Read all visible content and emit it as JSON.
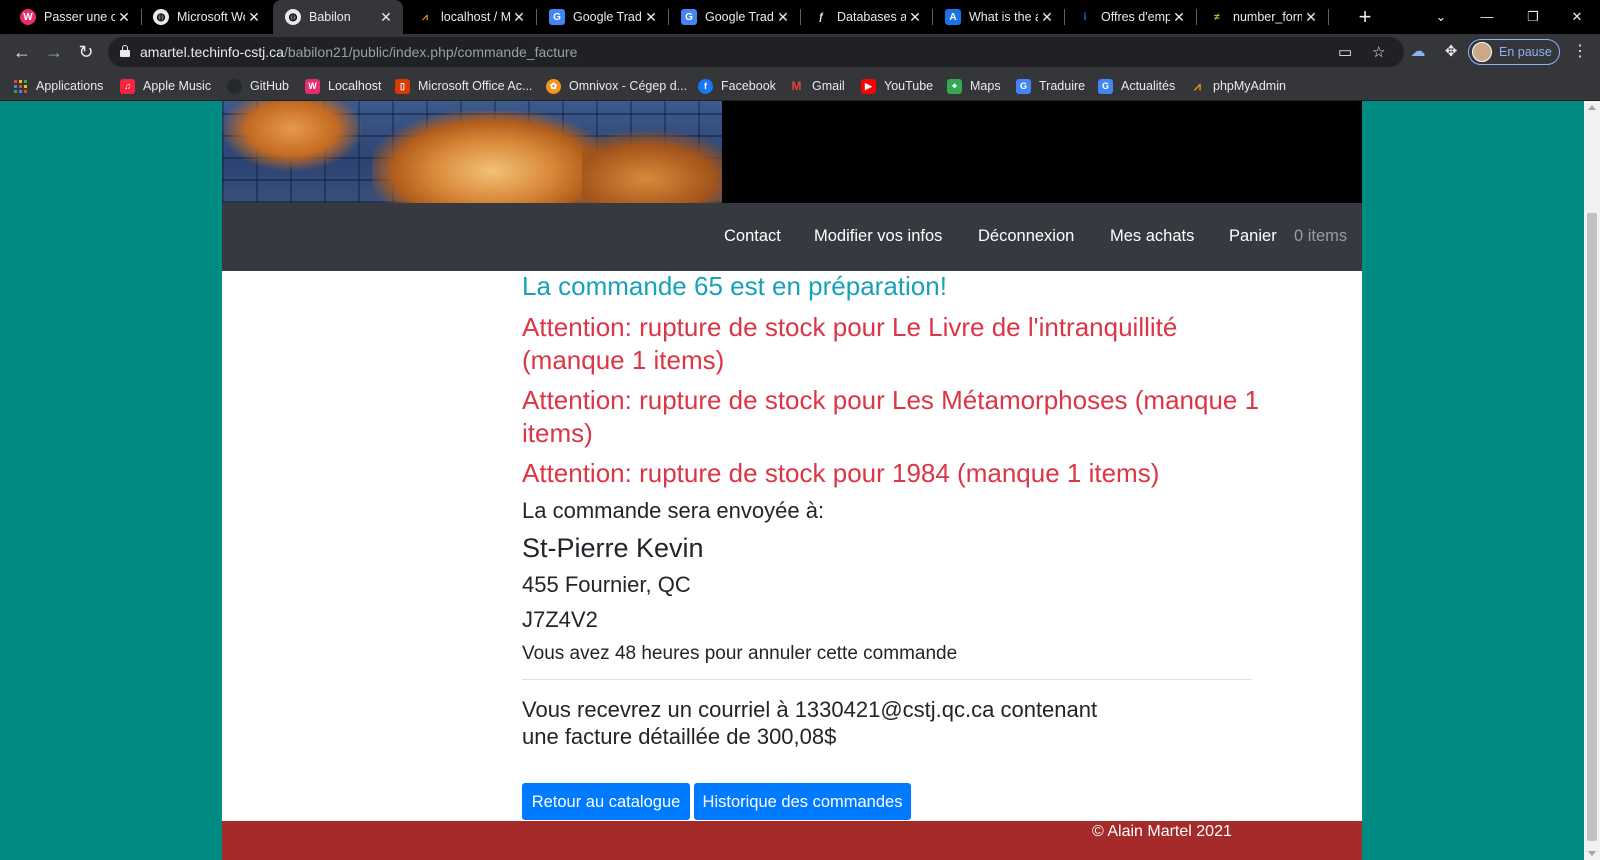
{
  "browser": {
    "tabs": [
      {
        "title": "Passer une co",
        "favicon": "localhost-icon",
        "color": "#e52e71"
      },
      {
        "title": "Microsoft Wo",
        "favicon": "globe-icon",
        "color": "#e8eaed"
      },
      {
        "title": "Babilon",
        "favicon": "globe-icon",
        "color": "#e8eaed"
      },
      {
        "title": "localhost / M",
        "favicon": "phpmyadmin-icon",
        "color": "#f29111"
      },
      {
        "title": "Google Tradu",
        "favicon": "google-translate-icon",
        "color": "#4285f4"
      },
      {
        "title": "Google Tradu",
        "favicon": "google-translate-icon",
        "color": "#4285f4"
      },
      {
        "title": "Databases an",
        "favicon": "symfony-icon",
        "color": "#e8eaed"
      },
      {
        "title": "What is the a",
        "favicon": "a-letter-icon",
        "color": "#1a73e8"
      },
      {
        "title": "Offres d'emp",
        "favicon": "info-icon",
        "color": "#1a73e8"
      },
      {
        "title": "number_form",
        "favicon": "stack-icon",
        "color": "#9acd32"
      }
    ],
    "url_host": "amartel.techinfo-cstj.ca",
    "url_path": "/babilon21/public/index.php/commande_facture",
    "profile_label": "En pause",
    "bookmarks": [
      {
        "label": "Applications",
        "icon": "apps-grid-icon",
        "color": ""
      },
      {
        "label": "Apple Music",
        "icon": "music-icon",
        "color": "#fa243c"
      },
      {
        "label": "GitHub",
        "icon": "github-icon",
        "color": "#24292e"
      },
      {
        "label": "Localhost",
        "icon": "localhost-icon",
        "color": "#e52e71"
      },
      {
        "label": "Microsoft Office Ac...",
        "icon": "office-icon",
        "color": "#d83b01"
      },
      {
        "label": "Omnivox - Cégep d...",
        "icon": "omnivox-icon",
        "color": "#f7941d"
      },
      {
        "label": "Facebook",
        "icon": "facebook-icon",
        "color": "#1877f2"
      },
      {
        "label": "Gmail",
        "icon": "gmail-icon",
        "color": "#ea4335"
      },
      {
        "label": "YouTube",
        "icon": "youtube-icon",
        "color": "#ff0000"
      },
      {
        "label": "Maps",
        "icon": "maps-icon",
        "color": "#34a853"
      },
      {
        "label": "Traduire",
        "icon": "google-translate-icon",
        "color": "#4285f4"
      },
      {
        "label": "Actualités",
        "icon": "news-icon",
        "color": "#4285f4"
      },
      {
        "label": "phpMyAdmin",
        "icon": "phpmyadmin-icon",
        "color": "#f29111"
      }
    ]
  },
  "site": {
    "nav": {
      "contact": "Contact",
      "edit_info": "Modifier vos infos",
      "logout": "Déconnexion",
      "purchases": "Mes achats",
      "cart": "Panier",
      "cart_count": "0 items"
    },
    "order": {
      "status_message": "La commande 65 est en préparation!",
      "warnings": [
        "Attention: rupture de stock pour Le Livre de l'intranquillité (manque 1 items)",
        "Attention: rupture de stock pour Les Métamorphoses (manque 1 items)",
        "Attention: rupture de stock pour 1984 (manque 1 items)"
      ],
      "ship_to_label": "La commande sera envoyée à:",
      "customer_name": "St-Pierre Kevin",
      "address": "455 Fournier, QC",
      "postal_code": "J7Z4V2",
      "cancel_note": "Vous avez 48 heures pour annuler cette commande",
      "email_line_1": "Vous recevrez un courriel à 1330421@cstj.qc.ca contenant",
      "email_line_2": "une facture détaillée de 300,08$"
    },
    "buttons": {
      "back_to_catalog": "Retour au catalogue",
      "order_history": "Historique des commandes"
    },
    "footer": "© Alain Martel 2021",
    "colors": {
      "background": "#008b82",
      "navbar": "#343a40",
      "info": "#17a2b8",
      "danger": "#dc3545",
      "primary": "#007bff",
      "footer": "#a52a2a"
    }
  }
}
